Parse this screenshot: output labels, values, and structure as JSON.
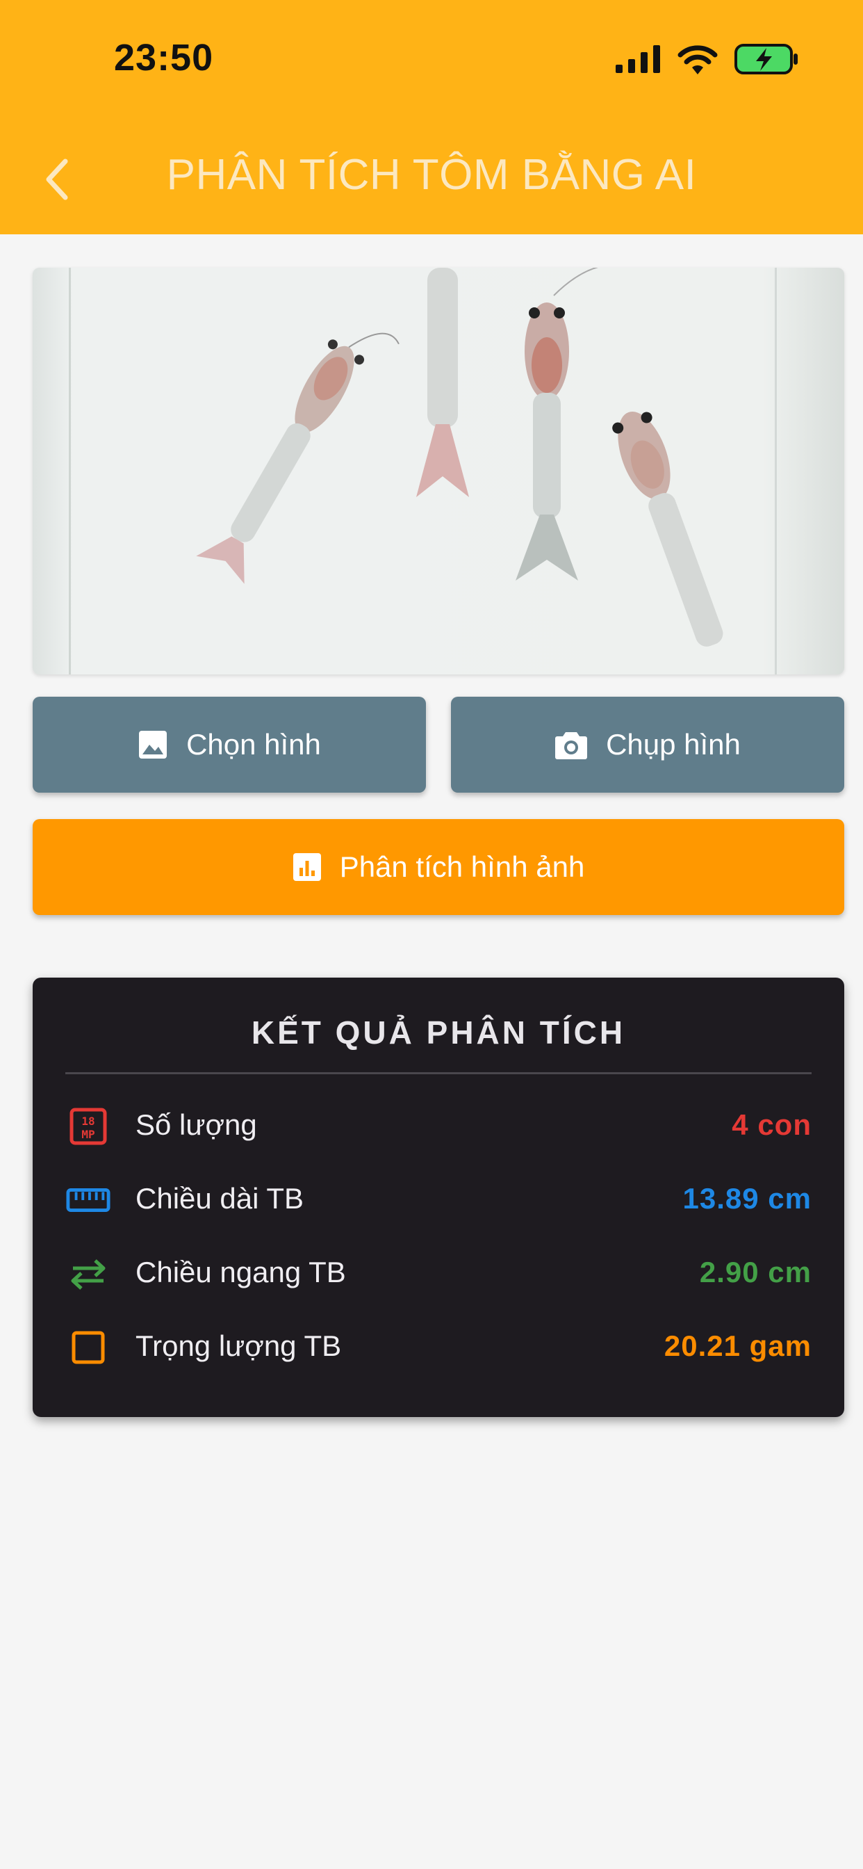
{
  "status_bar": {
    "time": "23:50"
  },
  "header": {
    "title": "PHÂN TÍCH TÔM BẰNG AI"
  },
  "actions": {
    "pick_label": "Chọn hình",
    "shoot_label": "Chụp hình",
    "analyze_label": "Phân tích hình ảnh"
  },
  "results": {
    "title": "KẾT QUẢ PHÂN TÍCH",
    "rows": [
      {
        "icon": "counter-icon",
        "label": "Số lượng",
        "value": "4 con",
        "color": "#E53935"
      },
      {
        "icon": "ruler-icon",
        "label": "Chiều dài TB",
        "value": "13.89 cm",
        "color": "#1E88E5"
      },
      {
        "icon": "swap-arrows-icon",
        "label": "Chiều ngang TB",
        "value": "2.90 cm",
        "color": "#43A047"
      },
      {
        "icon": "square-icon",
        "label": "Trọng lượng TB",
        "value": "20.21 gam",
        "color": "#FB8C00"
      }
    ]
  },
  "colors": {
    "header": "#FFB316",
    "secondary_button": "#607D8B",
    "primary_button": "#FF9800",
    "card": "#1E1B20"
  }
}
